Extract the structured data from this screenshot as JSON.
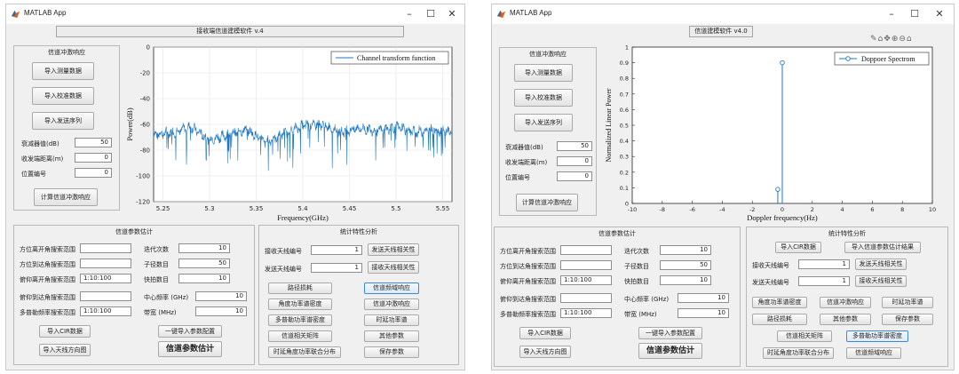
{
  "left": {
    "window_title": "MATLAB App",
    "app_title": "接收端信道建模软件 v.4",
    "panel_cir": {
      "title": "信道冲激响应",
      "buttons": [
        "导入测量数据",
        "导入校准数据",
        "导入发送序列"
      ],
      "fields": [
        {
          "label": "衰减器值(dB)",
          "value": "50"
        },
        {
          "label": "收发端距离(m)",
          "value": "0"
        },
        {
          "label": "位置编号",
          "value": "0"
        }
      ],
      "compute_button": "计算信道冲激响应"
    },
    "chart": {
      "legend": "Channel transform function",
      "xlabel": "Frequency(GHz)",
      "ylabel": "Power(dB)",
      "xticks": [
        "5.25",
        "5.3",
        "5.35",
        "5.4",
        "5.45",
        "5.5",
        "5.55"
      ],
      "yticks": [
        "0",
        "-20",
        "-40",
        "-60",
        "-80",
        "-100",
        "-120"
      ]
    },
    "panel_param": {
      "title": "信道参数估计",
      "left_fields": [
        {
          "label": "方位离开角搜索范围",
          "value": ""
        },
        {
          "label": "方位到达角搜索范围",
          "value": ""
        },
        {
          "label": "俯仰离开角搜索范围",
          "value": "1:10:100"
        },
        {
          "label": "俯仰到达角搜索范围",
          "value": ""
        },
        {
          "label": "多普勒频率搜索范围",
          "value": "1:10:100"
        }
      ],
      "right_fields": [
        {
          "label": "迭代次数",
          "value": "10"
        },
        {
          "label": "子径数目",
          "value": "50"
        },
        {
          "label": "快拍数目",
          "value": "10"
        },
        {
          "label": "中心频率 (GHz)",
          "value": "10"
        },
        {
          "label": "带宽 (MHz)",
          "value": "10"
        }
      ],
      "btn_import_cir": "导入CIR数据",
      "btn_import_config": "一键导入参数配置",
      "btn_import_antenna": "导入天线方向图",
      "btn_estimate": "信道参数估计"
    },
    "panel_stats": {
      "title": "统计特性分析",
      "rx_label": "接收天线编号",
      "rx_value": "1",
      "tx_label": "发送天线编号",
      "tx_value": "1",
      "btn_tx_corr": "发送天线相关性",
      "btn_rx_corr": "接收天线相关性",
      "grid": [
        [
          "路径损耗",
          "信道频域响应"
        ],
        [
          "角度功率谱密度",
          "信道冲激响应"
        ],
        [
          "多普勒功率谱密度",
          "时延功率谱"
        ],
        [
          "信道相关矩阵",
          "其他参数"
        ],
        [
          "时延角度功率联合分布",
          "保存参数"
        ]
      ]
    }
  },
  "right": {
    "window_title": "MATLAB App",
    "app_title": "信道建模软件 v4.0",
    "panel_cir": {
      "title": "信道冲激响应",
      "buttons": [
        "导入测量数据",
        "导入校准数据",
        "导入发送序列"
      ],
      "fields": [
        {
          "label": "衰减器值(dB)",
          "value": "50"
        },
        {
          "label": "收发端距离(m)",
          "value": "0"
        },
        {
          "label": "位置编号",
          "value": "0"
        }
      ],
      "compute_button": "计算信道冲激响应"
    },
    "chart": {
      "legend": "Doppoer Spectrom",
      "xlabel": "Doppler frequency(Hz)",
      "ylabel": "Normalized Linear Power",
      "xticks": [
        "-10",
        "-8",
        "-6",
        "-4",
        "-2",
        "0",
        "2",
        "4",
        "6",
        "8",
        "10"
      ],
      "yticks": [
        "0",
        "0.1",
        "0.2",
        "0.3",
        "0.4",
        "0.5",
        "0.6",
        "0.7",
        "0.8",
        "0.9",
        "1"
      ]
    },
    "panel_param": {
      "title": "信道参数估计",
      "left_fields": [
        {
          "label": "方位离开角搜索范围",
          "value": ""
        },
        {
          "label": "方位到达角搜索范围",
          "value": ""
        },
        {
          "label": "俯仰离开角搜索范围",
          "value": "1:10:100"
        },
        {
          "label": "俯仰到达角搜索范围",
          "value": ""
        },
        {
          "label": "多普勒频率搜索范围",
          "value": "1:10:100"
        }
      ],
      "right_fields": [
        {
          "label": "迭代次数",
          "value": "10"
        },
        {
          "label": "子径数目",
          "value": "50"
        },
        {
          "label": "快拍数目",
          "value": "10"
        },
        {
          "label": "中心频率 (GHz)",
          "value": "10"
        },
        {
          "label": "带宽 (MHz)",
          "value": "10"
        }
      ],
      "btn_import_cir": "导入CIR数据",
      "btn_import_config": "一键导入参数配置",
      "btn_import_antenna": "导入天线方向图",
      "btn_estimate": "信道参数估计"
    },
    "panel_stats": {
      "title": "统计特性分析",
      "btn_import_cir": "导入CIR数据",
      "btn_import_results": "导入信道参数估计结果",
      "rx_label": "接收天线编号",
      "rx_value": "1",
      "tx_label": "发送天线编号",
      "tx_value": "1",
      "btn_tx_corr": "发送天线相关性",
      "btn_rx_corr": "接收天线相关性",
      "row1": [
        "角度功率谱密度",
        "信道冲激响应",
        "时延功率谱"
      ],
      "row2": [
        "路径损耗",
        "其他参数",
        "保存参数"
      ],
      "row3": [
        "信道相关矩阵",
        "多普勒功率谱密度"
      ],
      "row4": [
        "时延角度功率联合分布",
        "信道频域响应"
      ]
    }
  },
  "chart_data": [
    {
      "type": "line",
      "title": "",
      "xlabel": "Frequency(GHz)",
      "ylabel": "Power(dB)",
      "xlim": [
        5.24,
        5.56
      ],
      "ylim": [
        -120,
        0
      ],
      "grid": true,
      "legend_position": "top-right",
      "series": [
        {
          "name": "Channel transform function",
          "x": [
            5.24,
            5.26,
            5.28,
            5.3,
            5.32,
            5.34,
            5.36,
            5.38,
            5.4,
            5.42,
            5.44,
            5.46,
            5.48,
            5.5,
            5.52,
            5.54,
            5.56
          ],
          "y": [
            -68,
            -66,
            -62,
            -72,
            -68,
            -64,
            -74,
            -67,
            -61,
            -60,
            -66,
            -63,
            -65,
            -62,
            -66,
            -64,
            -66
          ]
        }
      ]
    },
    {
      "type": "scatter",
      "title": "",
      "xlabel": "Doppler frequency(Hz)",
      "ylabel": "Normalized Linear Power",
      "xlim": [
        -10,
        10
      ],
      "ylim": [
        0,
        1
      ],
      "grid": false,
      "legend_position": "top-right",
      "series": [
        {
          "name": "Doppoer Spectrom",
          "x": [
            -0.3,
            0
          ],
          "y": [
            0.09,
            0.9
          ]
        }
      ]
    }
  ]
}
